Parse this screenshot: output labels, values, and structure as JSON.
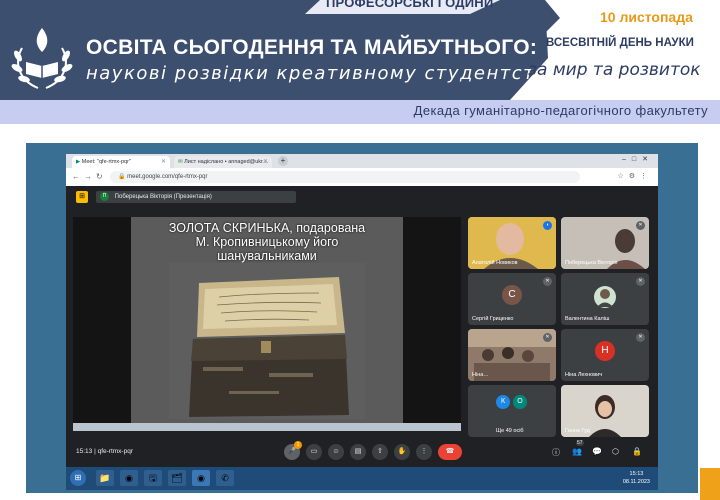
{
  "header": {
    "top_label": "ПРОФЕСОРСЬКІ ГОДИНИ",
    "title": "ОСВІТА СЬОГОДЕННЯ ТА МАЙБУТНЬОГО:",
    "subtitle": "наукові розвідки креативному студентству",
    "date": "10 листопада",
    "event": "ВСЕСВІТНІЙ ДЕНЬ НАУКИ",
    "motto": "за мир та розвиток",
    "faculty": "Декада гуманітарно-педагогічного факультету"
  },
  "colors": {
    "banner": "#3d4f6f",
    "faculty_bar": "#c7cdf0",
    "accent_orange": "#e69a18",
    "frame": "#3a6f94",
    "meet_dark": "#202124",
    "end_call": "#ea4335"
  },
  "browser": {
    "tabs": [
      {
        "label": "Meet: \"qfe-rtmx-pqr\"",
        "icon": "meet-icon"
      },
      {
        "label": "Лист надіслано • annaged@ukr…",
        "icon": "mail-icon"
      }
    ],
    "url": "meet.google.com/qfe-rtmx-pqr"
  },
  "meet": {
    "presenter_initial": "П",
    "presenter": "Поберецька Вікторія (Презентація)",
    "slide_title": "ЗОЛОТА СКРИНЬКА, подарована\nМ. Кропивницькому його\nшанувальниками",
    "participants": [
      {
        "name": "Анатолій Новиков",
        "kind": "video"
      },
      {
        "name": "Поберецька Вікторія",
        "kind": "video"
      },
      {
        "name": "Сергій Гриценко",
        "kind": "avatar",
        "initial": "С",
        "color": "#795548"
      },
      {
        "name": "Валентина Каліш",
        "kind": "photo"
      },
      {
        "name": "Ніна…",
        "kind": "video"
      },
      {
        "name": "Ніна Лехнович",
        "kind": "avatar",
        "initial": "Н",
        "color": "#d93025"
      },
      {
        "name": "Ще 49 осіб",
        "kind": "more",
        "initials": [
          "К",
          "О"
        ]
      },
      {
        "name": "Ганна Гуд",
        "kind": "video"
      }
    ],
    "time": "15:13",
    "meeting_code": "qfe-rtmx-pqr",
    "participant_count": "57",
    "badge_count": "1"
  },
  "taskbar": {
    "clock_time": "15:13",
    "clock_date": "08.11.2023"
  }
}
